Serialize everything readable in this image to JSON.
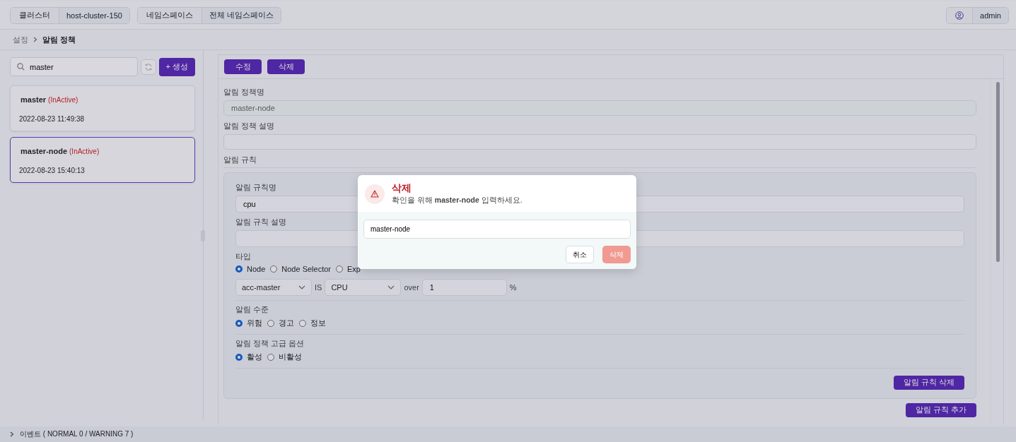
{
  "header": {
    "selectors": [
      {
        "label": "클러스터",
        "value": "host-cluster-150"
      },
      {
        "label": "네임스페이스",
        "value": "전체 네임스페이스"
      }
    ],
    "user": "admin"
  },
  "breadcrumb": [
    {
      "label": "설정",
      "selected": false
    },
    {
      "label": "알림 정책",
      "selected": true
    }
  ],
  "search": {
    "value": "master"
  },
  "create_button": "+ 생성",
  "policies": [
    {
      "name": "master",
      "status": "(InActive)",
      "date": "2022-08-23 11:49:38",
      "selected": false
    },
    {
      "name": "master-node",
      "status": "(InActive)",
      "date": "2022-08-23 15:40:13",
      "selected": true
    }
  ],
  "toolbar": [
    "수정",
    "삭제"
  ],
  "form": {
    "fields": [
      {
        "label": "알림 정책명",
        "value": "master-node",
        "disabled": true
      },
      {
        "label": "알림 정책 설명"
      }
    ],
    "rules_label": "알림 규칙",
    "rule": {
      "fields": [
        {
          "label": "알림 규칙명",
          "value": "cpu"
        },
        {
          "label": "알림 규칙 설명"
        }
      ],
      "type": {
        "label": "타입",
        "options": [
          {
            "label": "Node",
            "selected": true
          },
          {
            "label": "Node Selector",
            "selected": false
          },
          {
            "label": "Exp",
            "selected": false
          }
        ]
      },
      "condition": {
        "target": "acc-master",
        "is": "IS",
        "metric": "CPU",
        "over": "over",
        "threshold": "1",
        "unit": "%"
      },
      "level": {
        "label": "알림 수준",
        "options": [
          {
            "label": "위험",
            "selected": true
          },
          {
            "label": "경고",
            "selected": false
          },
          {
            "label": "정보",
            "selected": false
          }
        ]
      },
      "advanced": {
        "label": "알림 정책 고급 옵션",
        "options": [
          {
            "label": "활성",
            "selected": true
          },
          {
            "label": "비활성",
            "selected": false
          }
        ]
      },
      "delete_button": "알림 규칙 삭제"
    },
    "add_button": "알림 규칙 추가"
  },
  "modal": {
    "title": "삭제",
    "message": "확인을 위해 **master-node** 입력하세요.",
    "input": "master-node",
    "cancel": "취소",
    "confirm": {
      "label": "삭제",
      "disabled": true
    }
  },
  "footer": {
    "text": "이벤트 ( NORMAL 0 / WARNING 7 )"
  }
}
